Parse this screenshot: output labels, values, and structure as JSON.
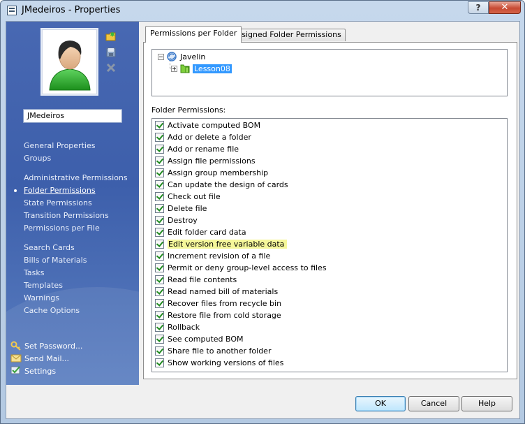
{
  "window": {
    "title": "JMedeiros - Properties",
    "help_label": "?",
    "close_label": "✕"
  },
  "sidebar": {
    "username": "JMedeiros",
    "nav_groups": [
      [
        "General Properties",
        "Groups"
      ],
      [
        "Administrative Permissions",
        "Folder Permissions",
        "State Permissions",
        "Transition Permissions",
        "Permissions per File"
      ],
      [
        "Search Cards",
        "Bills of Materials",
        "Tasks",
        "Templates",
        "Warnings",
        "Cache Options"
      ]
    ],
    "active_item": "Folder Permissions",
    "actions": [
      "Set Password...",
      "Send Mail...",
      "Settings"
    ]
  },
  "tabs": [
    "Permissions per Folder",
    "Assigned Folder Permissions"
  ],
  "tree": {
    "root": "Javelin",
    "child": "Lesson08"
  },
  "permissions_label": "Folder Permissions:",
  "permissions": [
    {
      "label": "Activate computed BOM",
      "checked": true
    },
    {
      "label": "Add or delete a folder",
      "checked": true
    },
    {
      "label": "Add or rename file",
      "checked": true
    },
    {
      "label": "Assign file permissions",
      "checked": true
    },
    {
      "label": "Assign group membership",
      "checked": true
    },
    {
      "label": "Can update the design of cards",
      "checked": true
    },
    {
      "label": "Check out file",
      "checked": true
    },
    {
      "label": "Delete file",
      "checked": true
    },
    {
      "label": "Destroy",
      "checked": true
    },
    {
      "label": "Edit folder card data",
      "checked": true
    },
    {
      "label": "Edit version free variable data",
      "checked": true,
      "highlighted": true
    },
    {
      "label": "Increment revision of a file",
      "checked": true
    },
    {
      "label": "Permit or deny group-level access to files",
      "checked": true
    },
    {
      "label": "Read file contents",
      "checked": true
    },
    {
      "label": "Read named bill of materials",
      "checked": true
    },
    {
      "label": "Recover files from recycle bin",
      "checked": true
    },
    {
      "label": "Restore file from cold storage",
      "checked": true
    },
    {
      "label": "Rollback",
      "checked": true
    },
    {
      "label": "See computed BOM",
      "checked": true
    },
    {
      "label": "Share file to another folder",
      "checked": true
    },
    {
      "label": "Show working versions of files",
      "checked": true
    }
  ],
  "buttons": {
    "ok": "OK",
    "cancel": "Cancel",
    "help": "Help"
  },
  "colors": {
    "sidebar": "#3d5fab",
    "highlight": "#f5f79a",
    "selection": "#3399ff"
  }
}
